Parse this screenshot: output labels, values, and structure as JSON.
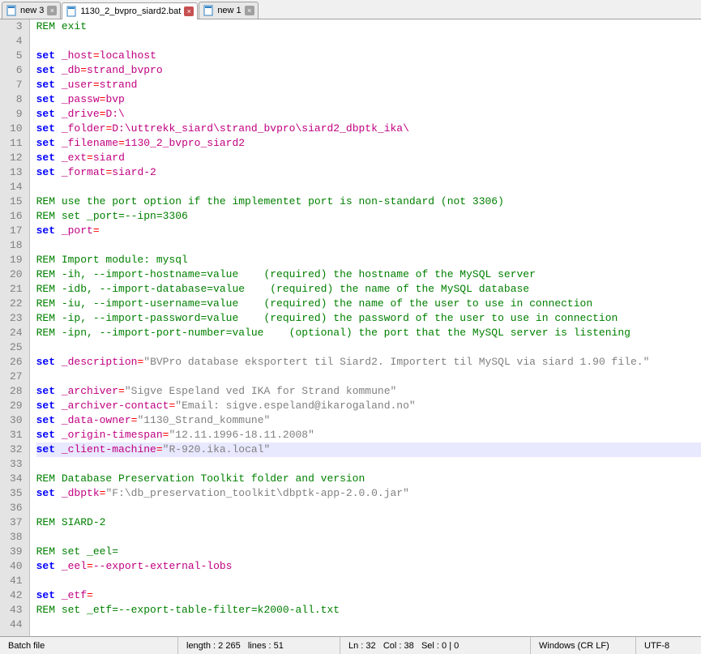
{
  "tabs": [
    {
      "label": "new 3",
      "active": false
    },
    {
      "label": "1130_2_bvpro_siard2.bat",
      "active": true
    },
    {
      "label": "new 1",
      "active": false
    }
  ],
  "lines": [
    {
      "n": 3,
      "t": "cm",
      "txt": "REM exit"
    },
    {
      "n": 4,
      "t": "",
      "txt": ""
    },
    {
      "n": 5,
      "t": "set",
      "var": "_host",
      "val": "localhost"
    },
    {
      "n": 6,
      "t": "set",
      "var": "_db",
      "val": "strand_bvpro"
    },
    {
      "n": 7,
      "t": "set",
      "var": "_user",
      "val": "strand"
    },
    {
      "n": 8,
      "t": "set",
      "var": "_passw",
      "val": "bvp"
    },
    {
      "n": 9,
      "t": "set",
      "var": "_drive",
      "val": "D:\\"
    },
    {
      "n": 10,
      "t": "set",
      "var": "_folder",
      "val": "D:\\uttrekk_siard\\strand_bvpro\\siard2_dbptk_ika\\"
    },
    {
      "n": 11,
      "t": "set",
      "var": "_filename",
      "val": "1130_2_bvpro_siard2"
    },
    {
      "n": 12,
      "t": "set",
      "var": "_ext",
      "val": "siard"
    },
    {
      "n": 13,
      "t": "set",
      "var": "_format",
      "val": "siard-2"
    },
    {
      "n": 14,
      "t": "",
      "txt": ""
    },
    {
      "n": 15,
      "t": "cm",
      "txt": "REM use the port option if the implementet port is non-standard (not 3306)"
    },
    {
      "n": 16,
      "t": "cm",
      "txt": "REM set _port=--ipn=3306"
    },
    {
      "n": 17,
      "t": "set",
      "var": "_port",
      "val": ""
    },
    {
      "n": 18,
      "t": "",
      "txt": ""
    },
    {
      "n": 19,
      "t": "cm",
      "txt": "REM Import module: mysql"
    },
    {
      "n": 20,
      "t": "cm",
      "txt": "REM -ih, --import-hostname=value    (required) the hostname of the MySQL server"
    },
    {
      "n": 21,
      "t": "cm",
      "txt": "REM -idb, --import-database=value    (required) the name of the MySQL database"
    },
    {
      "n": 22,
      "t": "cm",
      "txt": "REM -iu, --import-username=value    (required) the name of the user to use in connection"
    },
    {
      "n": 23,
      "t": "cm",
      "txt": "REM -ip, --import-password=value    (required) the password of the user to use in connection"
    },
    {
      "n": 24,
      "t": "cm",
      "txt": "REM -ipn, --import-port-number=value    (optional) the port that the MySQL server is listening"
    },
    {
      "n": 25,
      "t": "",
      "txt": ""
    },
    {
      "n": 26,
      "t": "set",
      "var": "_description",
      "val": "\"BVPro database eksportert til Siard2. Importert til MySQL via siard 1.90 file.\""
    },
    {
      "n": 27,
      "t": "",
      "txt": ""
    },
    {
      "n": 28,
      "t": "set",
      "var": "_archiver",
      "val": "\"Sigve Espeland ved IKA for Strand kommune\""
    },
    {
      "n": 29,
      "t": "set",
      "var": "_archiver-contact",
      "val": "\"Email: sigve.espeland@ikarogaland.no\""
    },
    {
      "n": 30,
      "t": "set",
      "var": "_data-owner",
      "val": "\"1130_Strand_kommune\""
    },
    {
      "n": 31,
      "t": "set",
      "var": "_origin-timespan",
      "val": "\"12.11.1996-18.11.2008\""
    },
    {
      "n": 32,
      "t": "set",
      "var": "_client-machine",
      "val": "\"R-920.ika.local\"",
      "current": true
    },
    {
      "n": 33,
      "t": "",
      "txt": ""
    },
    {
      "n": 34,
      "t": "cm",
      "txt": "REM Database Preservation Toolkit folder and version"
    },
    {
      "n": 35,
      "t": "set",
      "var": "_dbptk",
      "val": "\"F:\\db_preservation_toolkit\\dbptk-app-2.0.0.jar\""
    },
    {
      "n": 36,
      "t": "",
      "txt": ""
    },
    {
      "n": 37,
      "t": "cm",
      "txt": "REM SIARD-2"
    },
    {
      "n": 38,
      "t": "",
      "txt": ""
    },
    {
      "n": 39,
      "t": "cm",
      "txt": "REM set _eel="
    },
    {
      "n": 40,
      "t": "set",
      "var": "_eel",
      "val": "--export-external-lobs"
    },
    {
      "n": 41,
      "t": "",
      "txt": ""
    },
    {
      "n": 42,
      "t": "set",
      "var": "_etf",
      "val": ""
    },
    {
      "n": 43,
      "t": "cm",
      "txt": "REM set _etf=--export-table-filter=k2000-all.txt"
    },
    {
      "n": 44,
      "t": "",
      "txt": ""
    }
  ],
  "status": {
    "filetype": "Batch file",
    "length_label": "length :",
    "length_value": "2 265",
    "lines_label": "lines :",
    "lines_value": "51",
    "ln_label": "Ln :",
    "ln": "32",
    "col_label": "Col :",
    "col": "38",
    "sel_label": "Sel :",
    "sel": "0 | 0",
    "eol": "Windows (CR LF)",
    "encoding": "UTF-8"
  }
}
